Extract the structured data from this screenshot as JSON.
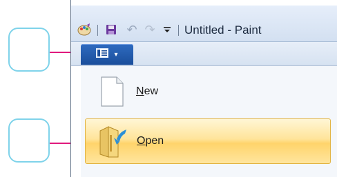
{
  "window": {
    "title": "Untitled - Paint"
  },
  "quick_access": {
    "icons": [
      "paint-palette-icon",
      "save-icon",
      "undo-icon",
      "redo-icon",
      "customize-dropdown-icon"
    ]
  },
  "ribbon": {
    "menu_button_icon": "paint-menu-icon",
    "menu_button_caret": "▾"
  },
  "menu": {
    "items": [
      {
        "label_access_key": "N",
        "label_rest": "ew",
        "icon": "new-document-icon",
        "highlighted": false
      },
      {
        "label_access_key": "O",
        "label_rest": "pen",
        "icon": "open-folder-icon",
        "highlighted": true
      }
    ]
  },
  "annotations": {
    "callout_count": 2,
    "arrow_color": "#e0197d",
    "callout_border": "#7fd3ea"
  },
  "colors": {
    "menu_button": "#1a4e9b",
    "highlight": "#ffe49a"
  }
}
